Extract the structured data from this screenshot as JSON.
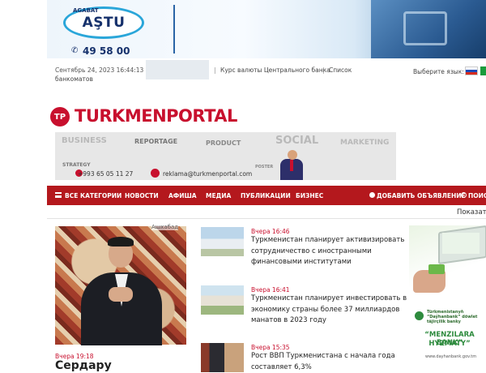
{
  "banner": {
    "logo_text": "AŞTU",
    "logo_small": "AGABAT",
    "phone": "49 58 00",
    "phone_icon": "phone-icon"
  },
  "info_bar": {
    "date": "Сентябрь 24, 2023  16:44:13",
    "exchange_link": "Курс валюты Центрального банка",
    "separator": "|",
    "atm_link_part1": "Список",
    "atm_link_part2": "банкоматов",
    "language_label": "Выберите язык:"
  },
  "logo": {
    "mark": "TP",
    "text": "TURKMENPORTAL",
    "color": "#c8102e"
  },
  "ad_strip": {
    "business": "BUSINESS",
    "report": "REPORTAGE",
    "product": "PRODUCT",
    "social": "SOCIAL",
    "marketing": "MARKETING",
    "strategy": "STRATEGY",
    "poster": "POSTER",
    "phone": "+993 65 05 11 27",
    "email": "reklama@turkmenportal.com"
  },
  "nav": {
    "all_categories": "ВСЕ КАТЕГОРИИ",
    "news": "НОВОСТИ",
    "afisha": "АФИША",
    "media": "МЕДИА",
    "publications": "ПУБЛИКАЦИИ",
    "business": "БИЗНЕС",
    "add_listing": "ДОБАВИТЬ ОБЪЯВЛЕНИЕ",
    "search": "ПОИСК",
    "bg_color": "#b4181d"
  },
  "filter": {
    "show_label": "Показать"
  },
  "featured": {
    "tag": "Ашхабад",
    "time": "Вчера 19:18",
    "title": "Сердару"
  },
  "news": [
    {
      "time": "Вчера 16:46",
      "title": "Туркменистан планирует активизировать сотрудничество с иностранными финансовыми институтами"
    },
    {
      "time": "Вчера 16:41",
      "title": "Туркменистан планирует инвестировать в экономику страны более 37 миллиардов манатов в 2023 году"
    },
    {
      "time": "Вчера 15:35",
      "title": "Рост ВВП Туркменистана с начала года составляет 6,3%"
    }
  ],
  "side_ad": {
    "bank_name": "Türkmenistanyň “Daýhanbank” döwlet täjirçilik banky",
    "slogan_line1": "“MENZILARA BANK”",
    "slogan_line2": "HYZMATY”",
    "url": "www.dayhanbank.gov.tm",
    "accent": "#2e8b3e"
  }
}
